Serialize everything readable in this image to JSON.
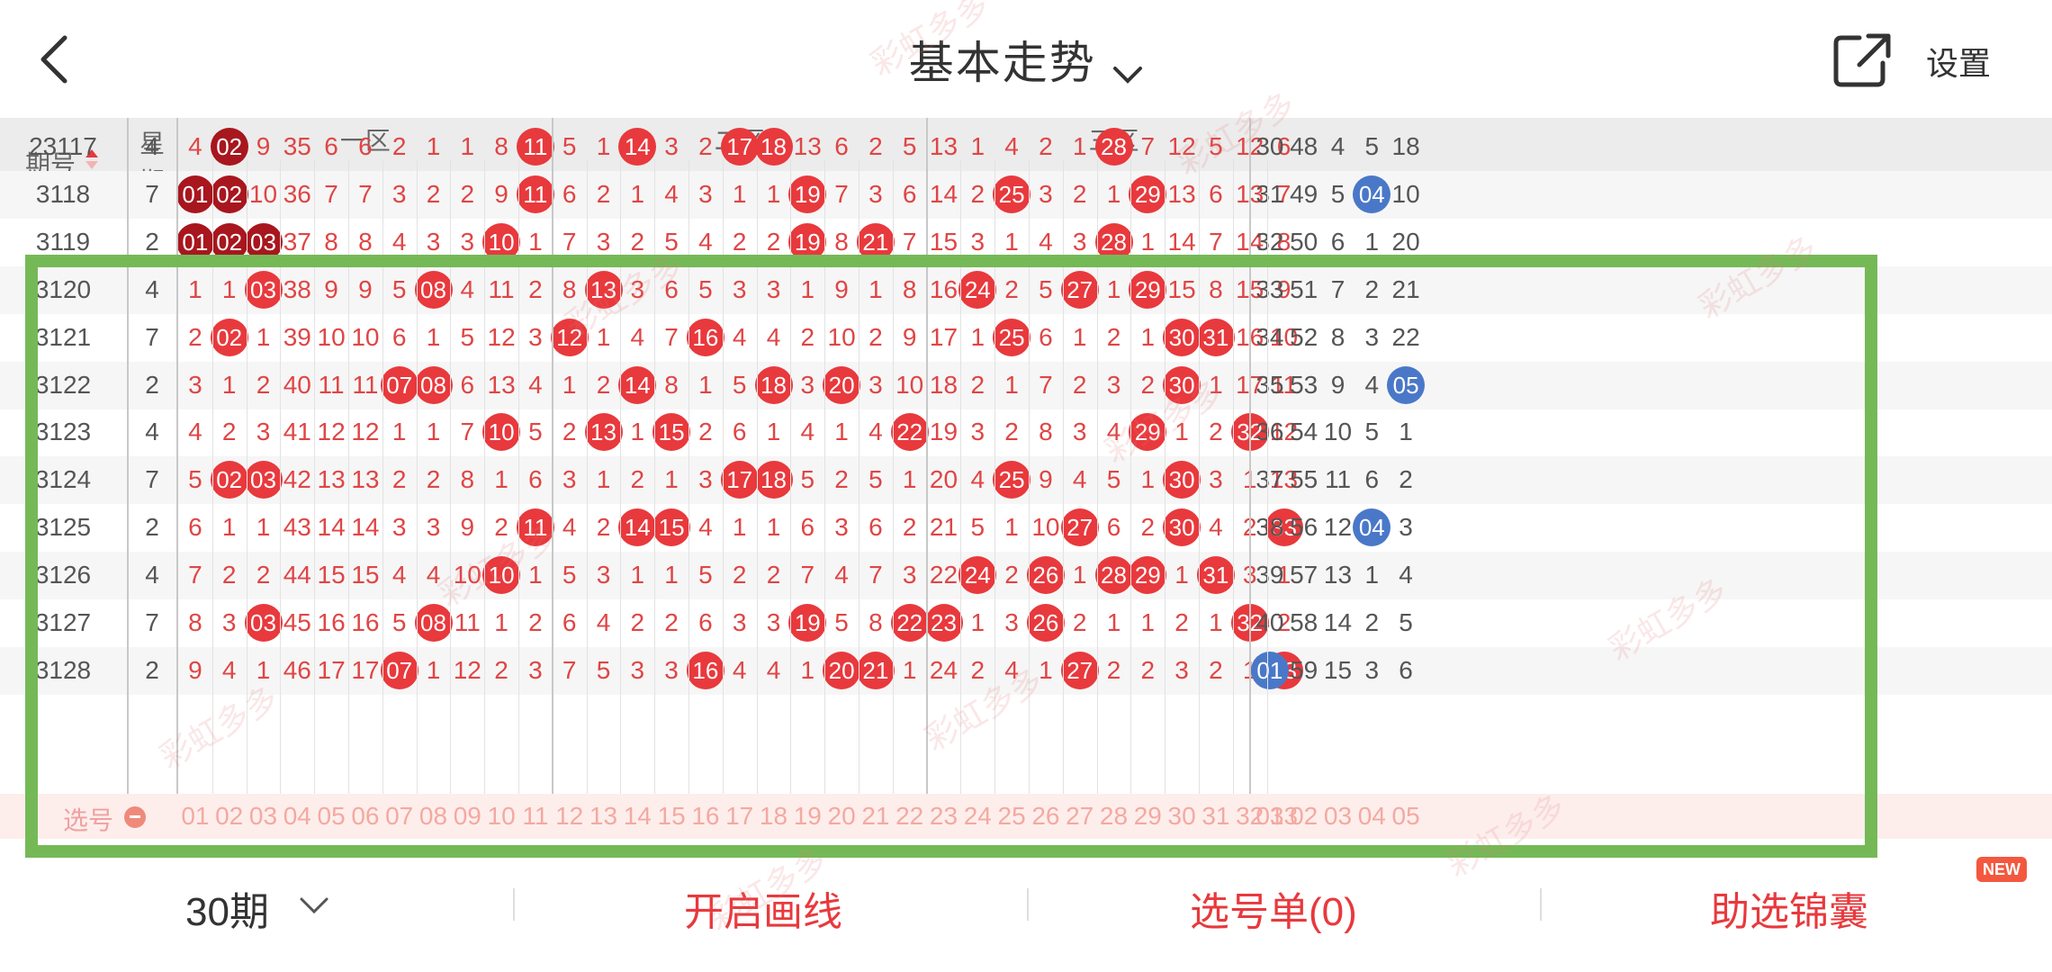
{
  "header": {
    "title": "基本走势",
    "settings_label": "设置"
  },
  "grid": {
    "col_issue_label": "期号",
    "col_week_label": "星期",
    "zones": [
      "一区",
      "二区",
      "三区"
    ],
    "front_numbers": [
      "01",
      "02",
      "03",
      "04",
      "05",
      "06",
      "07",
      "08",
      "09",
      "10",
      "11",
      "12",
      "13",
      "14",
      "15",
      "16",
      "17",
      "18",
      "19",
      "20",
      "21",
      "22",
      "23",
      "24",
      "25",
      "26",
      "27",
      "28",
      "29",
      "30",
      "31",
      "32",
      "33"
    ],
    "back_numbers": [
      "01",
      "02",
      "03",
      "04",
      "05"
    ],
    "selector_label": "选号",
    "rows": [
      {
        "issue": "23117",
        "week": "4",
        "cells": [
          "4",
          "02",
          "9",
          "35",
          "6",
          "6",
          "2",
          "1",
          "1",
          "8",
          "11",
          "5",
          "1",
          "14",
          "3",
          "2",
          "17",
          "18",
          "13",
          "6",
          "2",
          "5",
          "13",
          "1",
          "4",
          "2",
          "1",
          "28",
          "7",
          "12",
          "5",
          "12",
          "6"
        ],
        "back": [
          "30",
          "48",
          "4",
          "5",
          "18"
        ]
      },
      {
        "issue": "3118",
        "week": "7",
        "cells": [
          "01",
          "02",
          "10",
          "36",
          "7",
          "7",
          "3",
          "2",
          "2",
          "9",
          "11",
          "6",
          "2",
          "1",
          "4",
          "3",
          "1",
          "1",
          "19",
          "7",
          "3",
          "6",
          "14",
          "2",
          "25",
          "3",
          "2",
          "1",
          "29",
          "13",
          "6",
          "13",
          "7"
        ],
        "back": [
          "31",
          "49",
          "5",
          "04",
          "10"
        ]
      },
      {
        "issue": "3119",
        "week": "2",
        "cells": [
          "01",
          "02",
          "03",
          "37",
          "8",
          "8",
          "4",
          "3",
          "3",
          "10",
          "1",
          "7",
          "3",
          "2",
          "5",
          "4",
          "2",
          "2",
          "19",
          "8",
          "21",
          "7",
          "15",
          "3",
          "1",
          "4",
          "3",
          "28",
          "1",
          "14",
          "7",
          "14",
          "8"
        ],
        "back": [
          "32",
          "50",
          "6",
          "1",
          "20"
        ]
      },
      {
        "issue": "3120",
        "week": "4",
        "cells": [
          "1",
          "1",
          "03",
          "38",
          "9",
          "9",
          "5",
          "08",
          "4",
          "11",
          "2",
          "8",
          "13",
          "3",
          "6",
          "5",
          "3",
          "3",
          "1",
          "9",
          "1",
          "8",
          "16",
          "24",
          "2",
          "5",
          "27",
          "1",
          "29",
          "15",
          "8",
          "15",
          "9"
        ],
        "back": [
          "33",
          "51",
          "7",
          "2",
          "21"
        ]
      },
      {
        "issue": "3121",
        "week": "7",
        "cells": [
          "2",
          "02",
          "1",
          "39",
          "10",
          "10",
          "6",
          "1",
          "5",
          "12",
          "3",
          "12",
          "1",
          "4",
          "7",
          "16",
          "4",
          "4",
          "2",
          "10",
          "2",
          "9",
          "17",
          "1",
          "25",
          "6",
          "1",
          "2",
          "1",
          "30",
          "31",
          "16",
          "10"
        ],
        "back": [
          "34",
          "52",
          "8",
          "3",
          "22"
        ]
      },
      {
        "issue": "3122",
        "week": "2",
        "cells": [
          "3",
          "1",
          "2",
          "40",
          "11",
          "11",
          "07",
          "08",
          "6",
          "13",
          "4",
          "1",
          "2",
          "14",
          "8",
          "1",
          "5",
          "18",
          "3",
          "20",
          "3",
          "10",
          "18",
          "2",
          "1",
          "7",
          "2",
          "3",
          "2",
          "30",
          "1",
          "17",
          "11"
        ],
        "back": [
          "35",
          "53",
          "9",
          "4",
          "05"
        ]
      },
      {
        "issue": "3123",
        "week": "4",
        "cells": [
          "4",
          "2",
          "3",
          "41",
          "12",
          "12",
          "1",
          "1",
          "7",
          "10",
          "5",
          "2",
          "13",
          "1",
          "15",
          "2",
          "6",
          "1",
          "4",
          "1",
          "4",
          "22",
          "19",
          "3",
          "2",
          "8",
          "3",
          "4",
          "29",
          "1",
          "2",
          "32",
          "12"
        ],
        "back": [
          "36",
          "54",
          "10",
          "5",
          "1"
        ]
      },
      {
        "issue": "3124",
        "week": "7",
        "cells": [
          "5",
          "02",
          "03",
          "42",
          "13",
          "13",
          "2",
          "2",
          "8",
          "1",
          "6",
          "3",
          "1",
          "2",
          "1",
          "3",
          "17",
          "18",
          "5",
          "2",
          "5",
          "1",
          "20",
          "4",
          "25",
          "9",
          "4",
          "5",
          "1",
          "30",
          "3",
          "1",
          "13"
        ],
        "back": [
          "37",
          "55",
          "11",
          "6",
          "2"
        ]
      },
      {
        "issue": "3125",
        "week": "2",
        "cells": [
          "6",
          "1",
          "1",
          "43",
          "14",
          "14",
          "3",
          "3",
          "9",
          "2",
          "11",
          "4",
          "2",
          "14",
          "15",
          "4",
          "1",
          "1",
          "6",
          "3",
          "6",
          "2",
          "21",
          "5",
          "1",
          "10",
          "27",
          "6",
          "2",
          "30",
          "4",
          "2",
          "33"
        ],
        "back": [
          "38",
          "56",
          "12",
          "04",
          "3"
        ]
      },
      {
        "issue": "3126",
        "week": "4",
        "cells": [
          "7",
          "2",
          "2",
          "44",
          "15",
          "15",
          "4",
          "4",
          "10",
          "10",
          "1",
          "5",
          "3",
          "1",
          "1",
          "5",
          "2",
          "2",
          "7",
          "4",
          "7",
          "3",
          "22",
          "24",
          "2",
          "26",
          "1",
          "28",
          "29",
          "1",
          "31",
          "3",
          "1"
        ],
        "back": [
          "39",
          "57",
          "13",
          "1",
          "4"
        ]
      },
      {
        "issue": "3127",
        "week": "7",
        "cells": [
          "8",
          "3",
          "03",
          "45",
          "16",
          "16",
          "5",
          "08",
          "11",
          "1",
          "2",
          "6",
          "4",
          "2",
          "2",
          "6",
          "3",
          "3",
          "19",
          "5",
          "8",
          "22",
          "23",
          "1",
          "3",
          "26",
          "2",
          "1",
          "1",
          "2",
          "1",
          "32",
          "2"
        ],
        "back": [
          "40",
          "58",
          "14",
          "2",
          "5"
        ]
      },
      {
        "issue": "3128",
        "week": "2",
        "cells": [
          "9",
          "4",
          "1",
          "46",
          "17",
          "17",
          "07",
          "1",
          "12",
          "2",
          "3",
          "7",
          "5",
          "3",
          "3",
          "16",
          "4",
          "4",
          "1",
          "20",
          "21",
          "1",
          "24",
          "2",
          "4",
          "1",
          "27",
          "2",
          "2",
          "3",
          "2",
          "1",
          "33"
        ],
        "back": [
          "01",
          "59",
          "15",
          "3",
          "6"
        ]
      }
    ]
  },
  "footer": {
    "period_label": "30期",
    "draw_line_label": "开启画线",
    "pick_list_label": "选号单(0)",
    "helper_label": "助选锦囊",
    "new_badge": "NEW"
  },
  "colors": {
    "accent": "#e8393d",
    "dark_ball": "#a8161e",
    "blue_ball": "#4a78c8",
    "frame": "#75b957"
  },
  "watermark": "彩虹多多"
}
